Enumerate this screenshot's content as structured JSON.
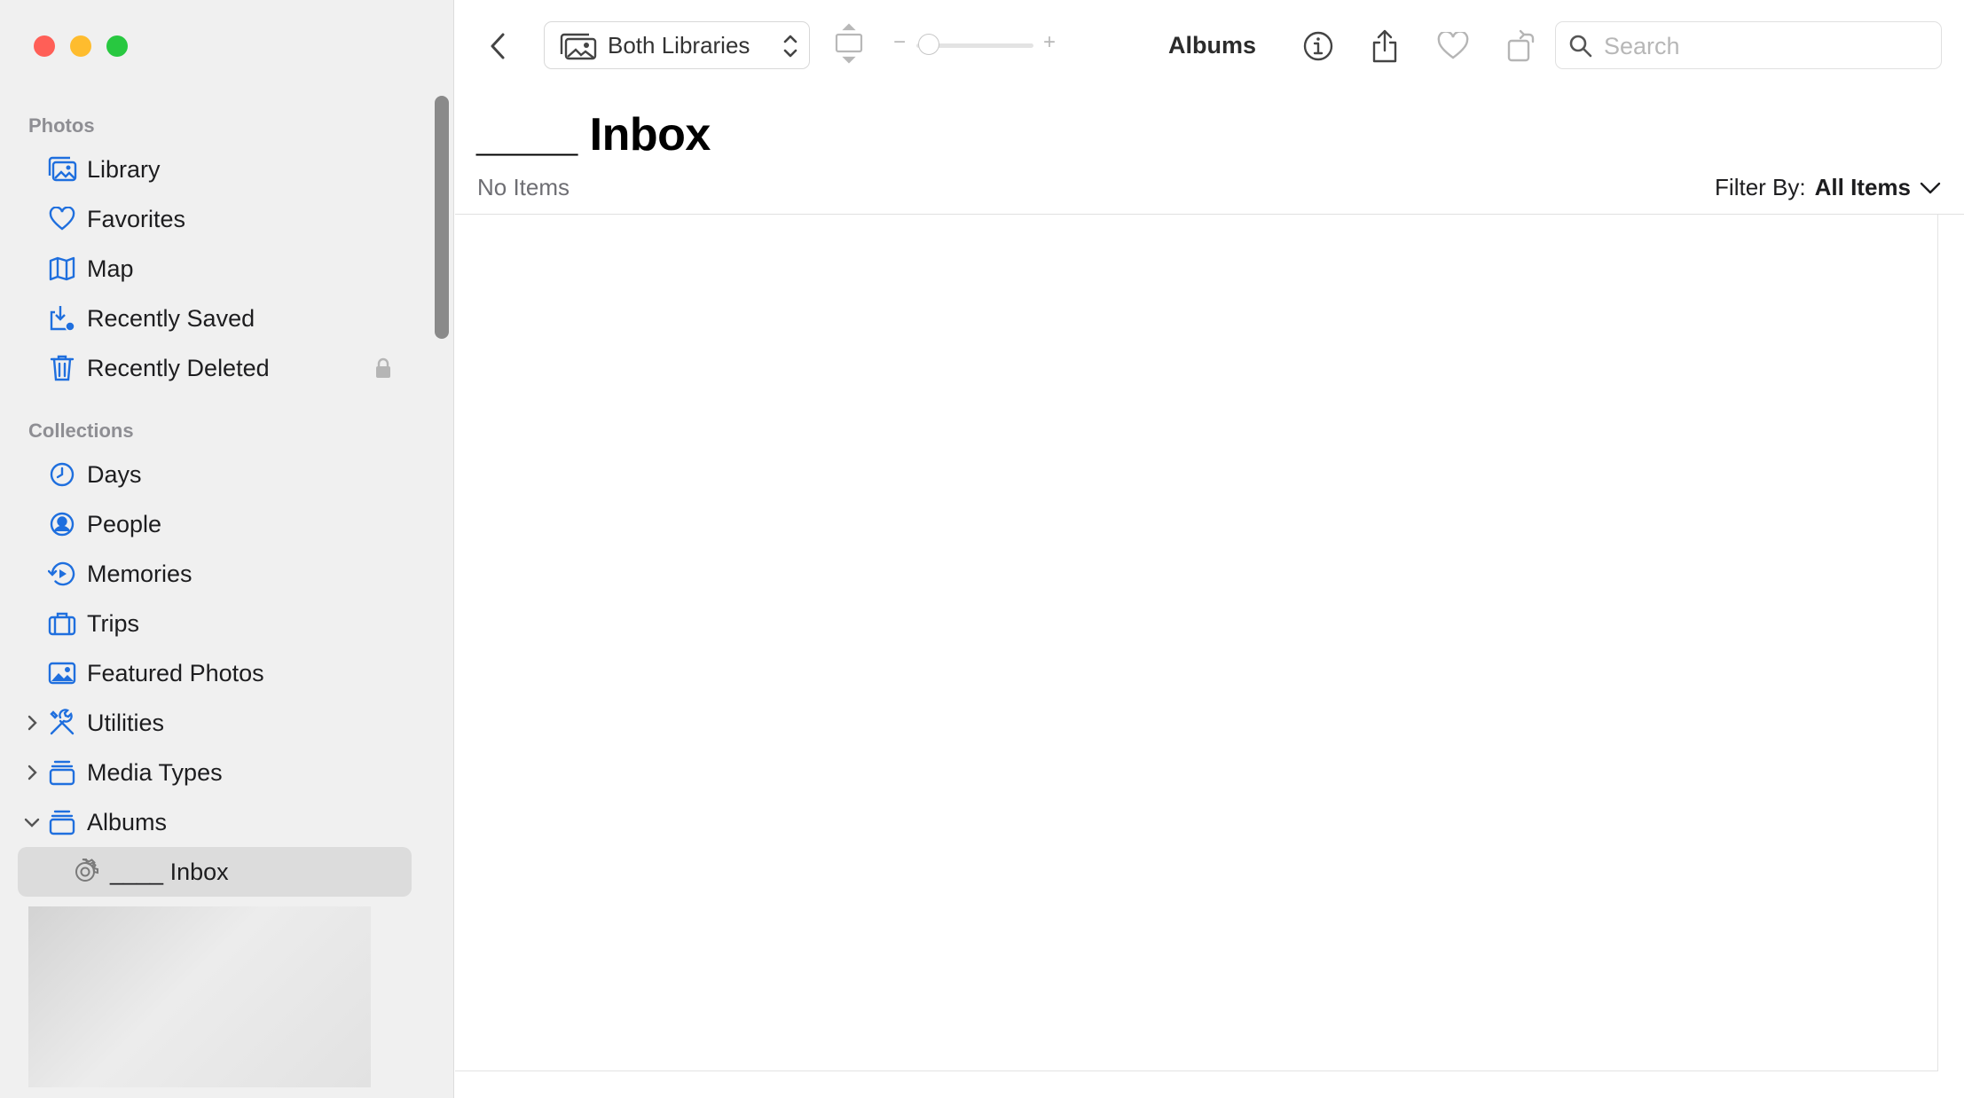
{
  "window": {
    "traffic_lights": {
      "close": "#ff5f57",
      "minimize": "#febc2e",
      "zoom": "#28c840"
    }
  },
  "sidebar": {
    "sections": [
      {
        "title": "Photos"
      },
      {
        "title": "Collections"
      }
    ],
    "photos_items": [
      {
        "label": "Library",
        "icon": "library-icon"
      },
      {
        "label": "Favorites",
        "icon": "heart-icon"
      },
      {
        "label": "Map",
        "icon": "map-icon"
      },
      {
        "label": "Recently Saved",
        "icon": "recently-saved-icon"
      },
      {
        "label": "Recently Deleted",
        "icon": "trash-icon",
        "locked": true
      }
    ],
    "collections_items": [
      {
        "label": "Days",
        "icon": "clock-icon"
      },
      {
        "label": "People",
        "icon": "person-icon"
      },
      {
        "label": "Memories",
        "icon": "memories-icon"
      },
      {
        "label": "Trips",
        "icon": "suitcase-icon"
      },
      {
        "label": "Featured Photos",
        "icon": "photo-icon"
      },
      {
        "label": "Utilities",
        "icon": "tools-icon",
        "expandable": true,
        "expanded": false
      },
      {
        "label": "Media Types",
        "icon": "stack-icon",
        "expandable": true,
        "expanded": false
      },
      {
        "label": "Albums",
        "icon": "stack-icon",
        "expandable": true,
        "expanded": true
      }
    ],
    "albums_children": [
      {
        "label": "____ Inbox",
        "icon": "gear-icon",
        "selected": true
      }
    ],
    "accent_color": "#1f6fde"
  },
  "toolbar": {
    "library_selector": "Both Libraries",
    "title": "Albums",
    "zoom_minus": "−",
    "zoom_plus": "+",
    "zoom_level": 0.0,
    "search_placeholder": "Search"
  },
  "content": {
    "title": "____ Inbox",
    "subtitle": "No Items",
    "filter_label": "Filter By:",
    "filter_value": "All Items"
  }
}
